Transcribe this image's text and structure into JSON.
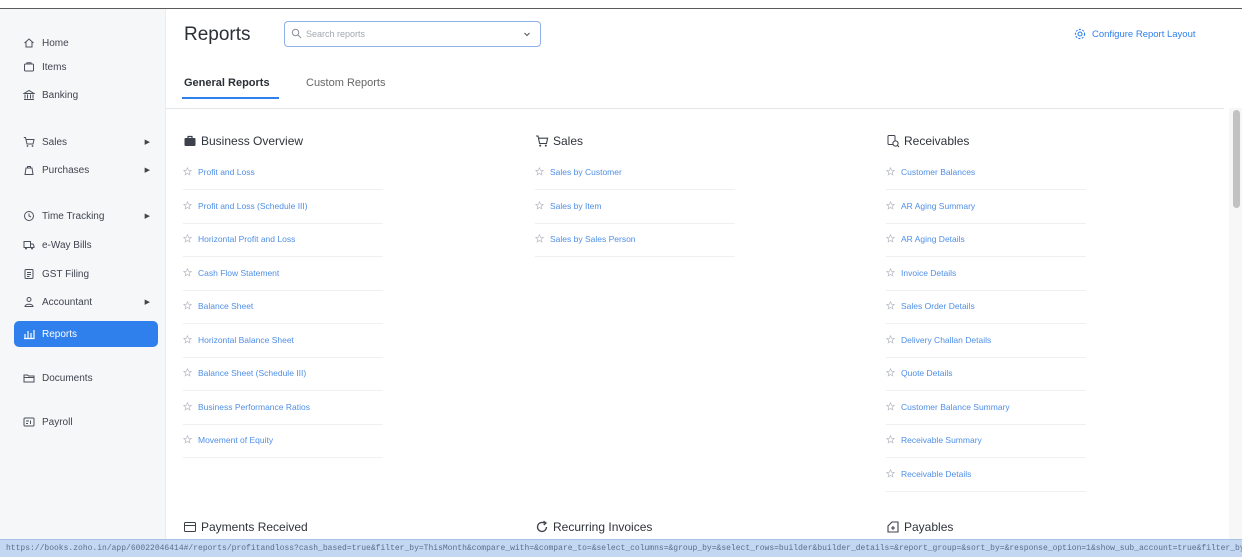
{
  "sidebar": {
    "items": [
      {
        "label": "Home",
        "icon": "home-icon",
        "has_caret": false,
        "active": false
      },
      {
        "label": "Items",
        "icon": "items-icon",
        "has_caret": false,
        "active": false
      },
      {
        "label": "Banking",
        "icon": "bank-icon",
        "has_caret": false,
        "active": false
      },
      {
        "label": "Sales",
        "icon": "cart-icon",
        "has_caret": true,
        "active": false
      },
      {
        "label": "Purchases",
        "icon": "bag-icon",
        "has_caret": true,
        "active": false
      },
      {
        "label": "Time Tracking",
        "icon": "clock-icon",
        "has_caret": true,
        "active": false
      },
      {
        "label": "e-Way Bills",
        "icon": "truck-icon",
        "has_caret": false,
        "active": false
      },
      {
        "label": "GST Filing",
        "icon": "document-icon",
        "has_caret": false,
        "active": false
      },
      {
        "label": "Accountant",
        "icon": "user-icon",
        "has_caret": true,
        "active": false
      },
      {
        "label": "Reports",
        "icon": "chart-icon",
        "has_caret": false,
        "active": true
      },
      {
        "label": "Documents",
        "icon": "folder-icon",
        "has_caret": false,
        "active": false
      },
      {
        "label": "Payroll",
        "icon": "payroll-icon",
        "has_caret": false,
        "active": false
      }
    ]
  },
  "header": {
    "title": "Reports",
    "search_placeholder": "Search reports",
    "configure_label": "Configure Report Layout"
  },
  "tabs": {
    "general": "General Reports",
    "custom": "Custom Reports"
  },
  "sections": {
    "business": {
      "title": "Business Overview",
      "items": [
        "Profit and Loss",
        "Profit and Loss (Schedule III)",
        "Horizontal Profit and Loss",
        "Cash Flow Statement",
        "Balance Sheet",
        "Horizontal Balance Sheet",
        "Balance Sheet (Schedule III)",
        "Business Performance Ratios",
        "Movement of Equity"
      ]
    },
    "sales": {
      "title": "Sales",
      "items": [
        "Sales by Customer",
        "Sales by Item",
        "Sales by Sales Person"
      ]
    },
    "receivables": {
      "title": "Receivables",
      "items": [
        "Customer Balances",
        "AR Aging Summary",
        "AR Aging Details",
        "Invoice Details",
        "Sales Order Details",
        "Delivery Challan Details",
        "Quote Details",
        "Customer Balance Summary",
        "Receivable Summary",
        "Receivable Details"
      ]
    },
    "payments": {
      "title": "Payments Received"
    },
    "recurring": {
      "title": "Recurring Invoices"
    },
    "payables": {
      "title": "Payables"
    }
  },
  "statusbar": {
    "url": "https://books.zoho.in/app/60022046414#/reports/profitandloss?cash_based=true&filter_by=ThisMonth&compare_with=&compare_to=&select_columns=&group_by=&select_rows=builder&builder_details=&report_group=&sort_by=&response_option=1&show_sub_account=true&filter_by_group="
  },
  "colors": {
    "accent": "#2f80ed",
    "link": "#4f8fe6",
    "sidebar_bg": "#f6f7f9"
  }
}
